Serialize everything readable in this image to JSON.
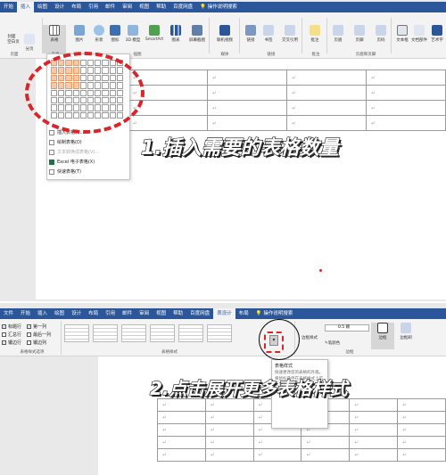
{
  "top": {
    "tabs": [
      "开始",
      "插入",
      "绘图",
      "设计",
      "布局",
      "引用",
      "邮件",
      "审阅",
      "视图",
      "帮助",
      "百度网盘",
      "操作说明搜索"
    ],
    "active_tab": "插入",
    "ribbon_buttons": [
      "封面",
      "空白页",
      "分页",
      "表格",
      "图片",
      "形状",
      "图标",
      "3D 模型",
      "SmartArt",
      "图表",
      "屏幕截图",
      "联机视频",
      "链接",
      "书签",
      "交叉引用",
      "批注",
      "页眉",
      "页脚",
      "页码",
      "文本框",
      "文档部件",
      "艺术字"
    ],
    "groups": [
      "页面",
      "表格",
      "插图",
      "媒体",
      "链接",
      "批注",
      "页眉和页脚"
    ],
    "dropdown": {
      "title": "插入表格",
      "items": [
        "插入表格(I)...",
        "绘制表格(D)",
        "文本转换成表格(V)...",
        "Excel 电子表格(X)",
        "快速表格(T)"
      ]
    },
    "caption": "1.插入需要的表格数量",
    "cell_mark": "↵"
  },
  "bottom": {
    "tabs": [
      "文件",
      "开始",
      "插入",
      "绘图",
      "设计",
      "布局",
      "引用",
      "邮件",
      "审阅",
      "视图",
      "帮助",
      "百度网盘",
      "表设计",
      "布局",
      "操作说明搜索"
    ],
    "active_tab": "表设计",
    "options": [
      "标题行",
      "第一列",
      "汇总行",
      "最后一列",
      "镶边行",
      "镶边列"
    ],
    "groups": [
      "表格样式选项",
      "表格样式",
      "边框"
    ],
    "border_width": "0.5 磅",
    "border_buttons": [
      "边框样式",
      "笔颜色",
      "边框",
      "边框刷"
    ],
    "tooltip": {
      "title": "表格样式",
      "body": "快速更改您的表格的外观。将鼠标悬停在表格样式上可在文档中查看预览。"
    },
    "caption": "2.点击展开更多表格样式",
    "cell_mark": "↵"
  },
  "colors": {
    "ribbon_blue": "#2b579a",
    "red_mark": "#d9252a",
    "grid_highlight": "#f8c9a6"
  }
}
